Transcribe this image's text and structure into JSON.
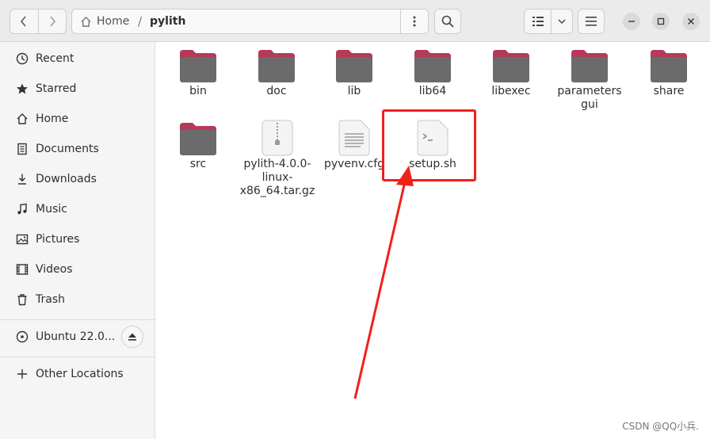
{
  "header": {
    "path": {
      "home_label": "Home",
      "separator": "/",
      "current": "pylith"
    }
  },
  "sidebar": {
    "items": [
      {
        "label": "Recent",
        "icon": "clock-icon"
      },
      {
        "label": "Starred",
        "icon": "star-icon"
      },
      {
        "label": "Home",
        "icon": "home-icon"
      },
      {
        "label": "Documents",
        "icon": "document-icon"
      },
      {
        "label": "Downloads",
        "icon": "download-icon"
      },
      {
        "label": "Music",
        "icon": "music-icon"
      },
      {
        "label": "Pictures",
        "icon": "picture-icon"
      },
      {
        "label": "Videos",
        "icon": "video-icon"
      },
      {
        "label": "Trash",
        "icon": "trash-icon"
      }
    ],
    "volume": {
      "label": "Ubuntu 22.0...",
      "icon": "disk-icon"
    },
    "other": {
      "label": "Other Locations",
      "icon": "plus-icon"
    }
  },
  "files": [
    {
      "name": "bin",
      "type": "folder"
    },
    {
      "name": "doc",
      "type": "folder"
    },
    {
      "name": "lib",
      "type": "folder"
    },
    {
      "name": "lib64",
      "type": "folder"
    },
    {
      "name": "libexec",
      "type": "folder"
    },
    {
      "name": "parameters gui",
      "type": "folder"
    },
    {
      "name": "share",
      "type": "folder"
    },
    {
      "name": "src",
      "type": "folder"
    },
    {
      "name": "pylith-4.0.0-linux-x86_64.tar.gz",
      "type": "archive"
    },
    {
      "name": "pyvenv.cfg",
      "type": "text"
    },
    {
      "name": "setup.sh",
      "type": "script"
    }
  ],
  "annotation_color": "#f0201b",
  "folder_colors": {
    "body": "#6b6b6b",
    "tab": "#b43b58"
  },
  "watermark": "CSDN @QQ小兵."
}
